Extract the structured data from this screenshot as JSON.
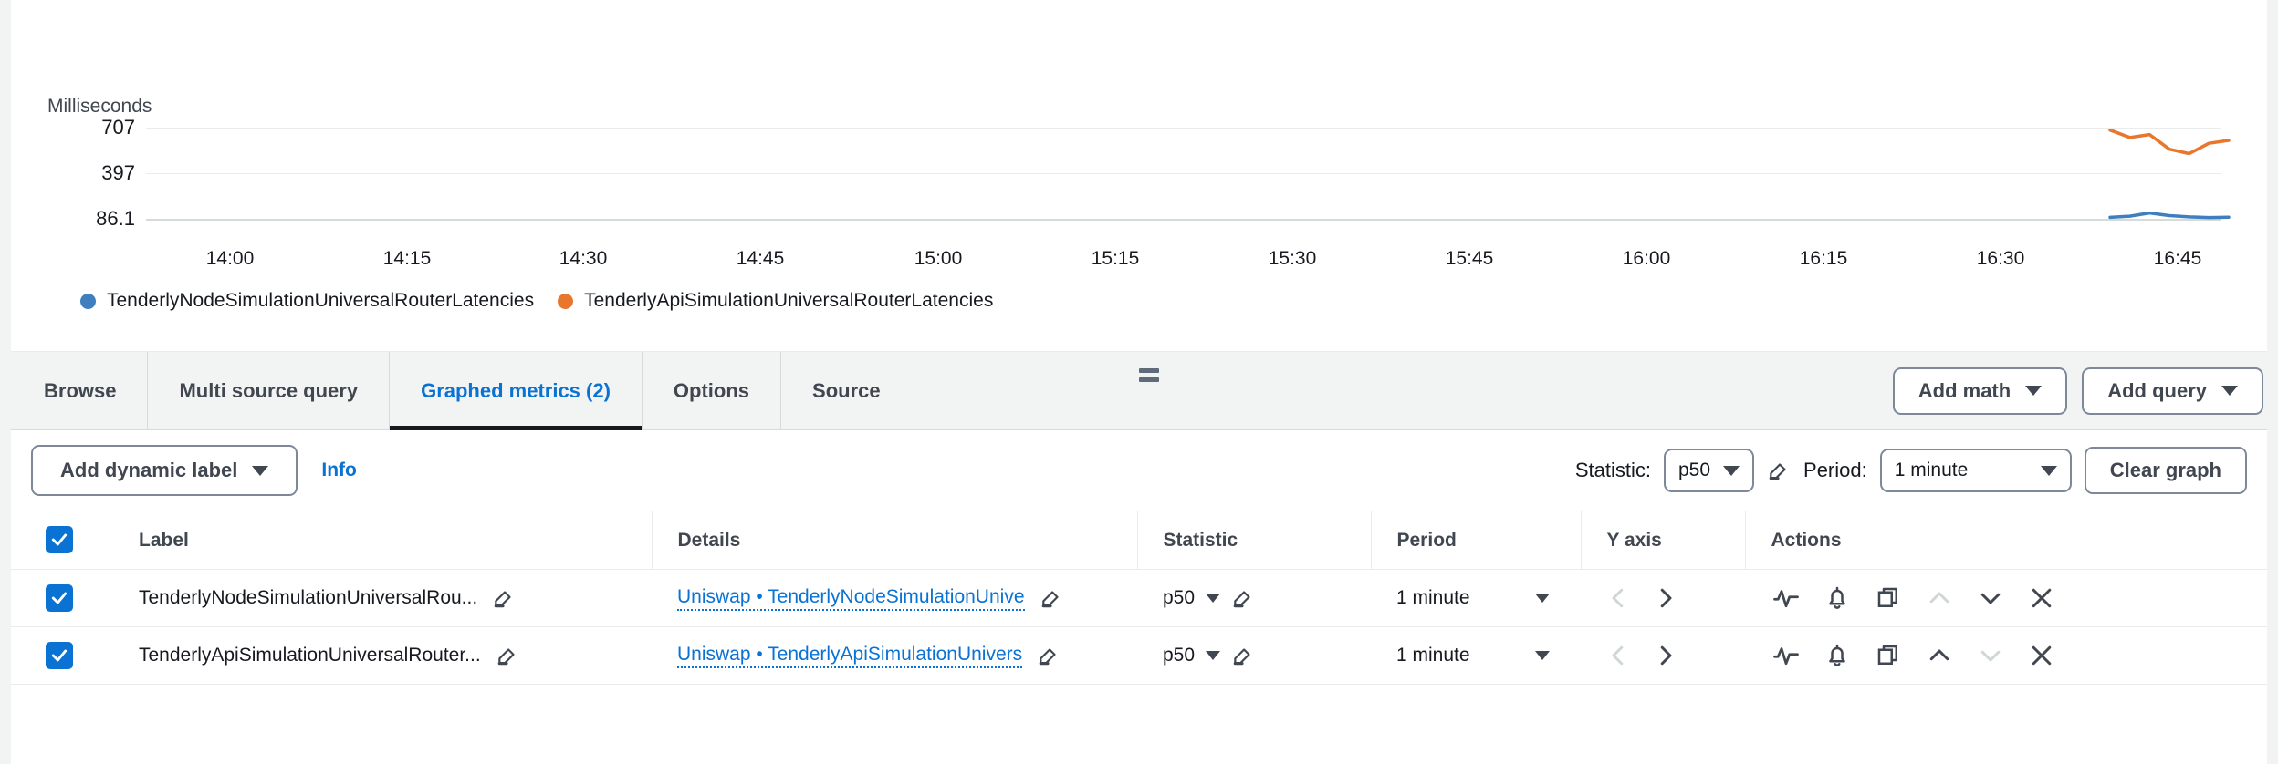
{
  "chart": {
    "y_axis_title": "Milliseconds",
    "legend": [
      {
        "label": "TenderlyNodeSimulationUniversalRouterLatencies",
        "color": "#3f7fbf"
      },
      {
        "label": "TenderlyApiSimulationUniversalRouterLatencies",
        "color": "#e8762c"
      }
    ]
  },
  "chart_data": {
    "type": "line",
    "title": "",
    "xlabel": "",
    "ylabel": "Milliseconds",
    "ytick_labels": [
      "707",
      "397",
      "86.1"
    ],
    "yvalues": [
      707,
      397,
      86.1
    ],
    "ylim": [
      86.1,
      707
    ],
    "grid": true,
    "legend_position": "bottom",
    "xtick_labels": [
      "14:00",
      "14:15",
      "14:30",
      "14:45",
      "15:00",
      "15:15",
      "15:30",
      "15:45",
      "16:00",
      "16:15",
      "16:30",
      "16:45"
    ],
    "x": [
      "16:38",
      "16:40",
      "16:42",
      "16:44",
      "16:46",
      "16:48",
      "16:50"
    ],
    "series": [
      {
        "name": "TenderlyNodeSimulationUniversalRouterLatencies",
        "color": "#3f7fbf",
        "values": [
          96,
          104,
          126,
          108,
          99,
          95,
          97
        ]
      },
      {
        "name": "TenderlyApiSimulationUniversalRouterLatencies",
        "color": "#e8762c",
        "values": [
          690,
          640,
          660,
          560,
          530,
          600,
          620
        ]
      }
    ]
  },
  "tabs": [
    {
      "label": "Browse",
      "active": false
    },
    {
      "label": "Multi source query",
      "active": false
    },
    {
      "label": "Graphed metrics (2)",
      "active": true
    },
    {
      "label": "Options",
      "active": false
    },
    {
      "label": "Source",
      "active": false
    }
  ],
  "tabs_actions": {
    "add_math": "Add math",
    "add_query": "Add query"
  },
  "controls": {
    "add_dynamic_label": "Add dynamic label",
    "info": "Info",
    "statistic_label": "Statistic:",
    "statistic_value": "p50",
    "period_label": "Period:",
    "period_value": "1 minute",
    "clear_graph": "Clear graph"
  },
  "table": {
    "headers": {
      "label": "Label",
      "details": "Details",
      "statistic": "Statistic",
      "period": "Period",
      "yaxis": "Y axis",
      "actions": "Actions"
    },
    "rows": [
      {
        "checked": true,
        "color": "#3f7fbf",
        "label": "TenderlyNodeSimulationUniversalRou...",
        "details": "Uniswap • TenderlyNodeSimulationUnive",
        "statistic": "p50",
        "period": "1 minute"
      },
      {
        "checked": true,
        "color": "#e8762c",
        "label": "TenderlyApiSimulationUniversalRouter...",
        "details": "Uniswap • TenderlyApiSimulationUnivers",
        "statistic": "p50",
        "period": "1 minute"
      }
    ]
  }
}
